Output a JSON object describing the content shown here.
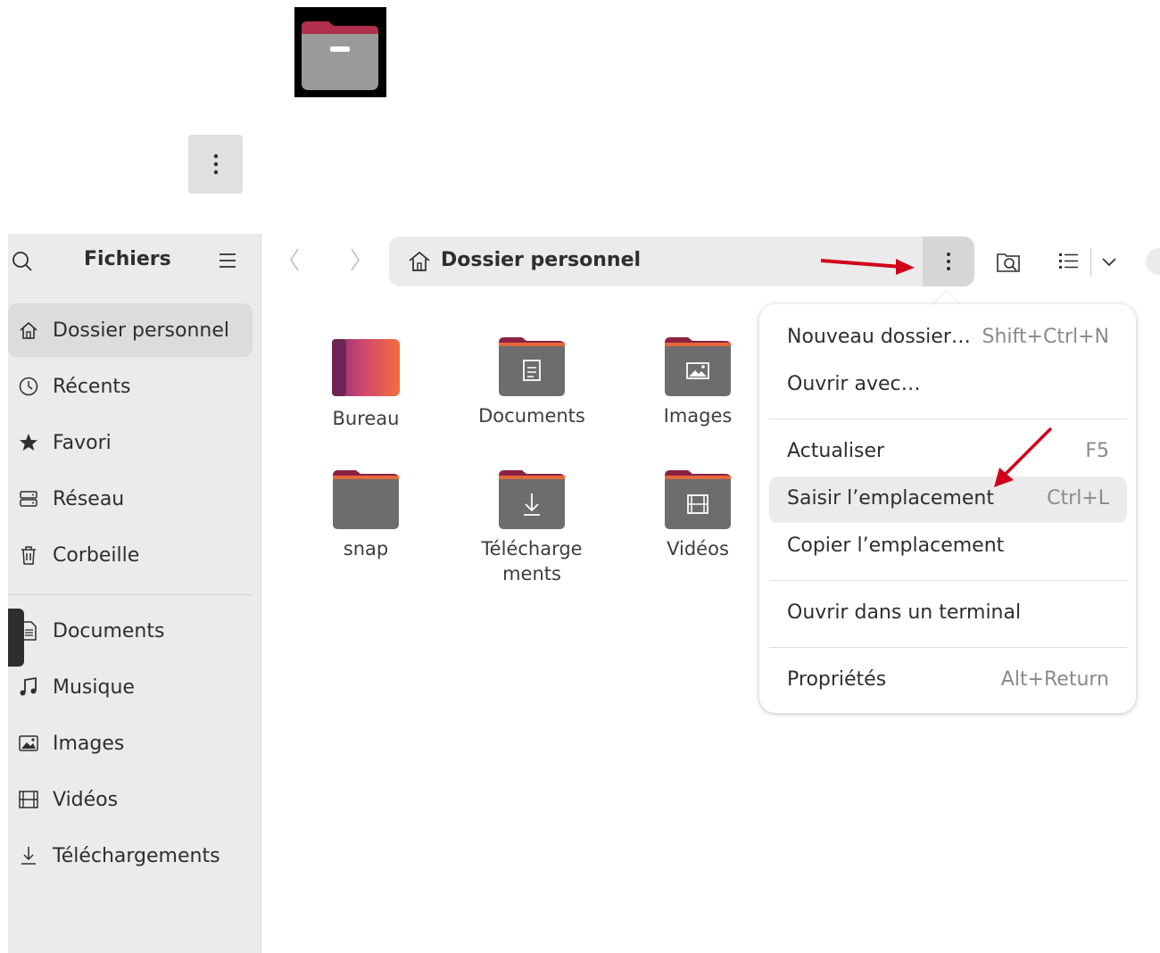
{
  "sidebar": {
    "title": "Fichiers",
    "items": [
      {
        "label": "Dossier personnel",
        "icon": "home-icon"
      },
      {
        "label": "Récents",
        "icon": "clock-icon"
      },
      {
        "label": "Favori",
        "icon": "star-icon"
      },
      {
        "label": "Réseau",
        "icon": "network-icon"
      },
      {
        "label": "Corbeille",
        "icon": "trash-icon"
      },
      {
        "label": "Documents",
        "icon": "document-icon"
      },
      {
        "label": "Musique",
        "icon": "music-icon"
      },
      {
        "label": "Images",
        "icon": "image-icon"
      },
      {
        "label": "Vidéos",
        "icon": "video-icon"
      },
      {
        "label": "Téléchargements",
        "icon": "download-icon"
      }
    ]
  },
  "header": {
    "path": "Dossier personnel"
  },
  "files": [
    {
      "name": "Bureau",
      "icon": "desktop-folder-icon"
    },
    {
      "name": "Documents",
      "icon": "documents-folder-icon"
    },
    {
      "name": "Images",
      "icon": "images-folder-icon"
    },
    {
      "name": "snap",
      "icon": "folder-icon"
    },
    {
      "name": "Télécharge\nments",
      "icon": "downloads-folder-icon"
    },
    {
      "name": "Vidéos",
      "icon": "videos-folder-icon"
    }
  ],
  "menu": {
    "items": [
      {
        "label": "Nouveau dossier…",
        "accel": "Shift+Ctrl+N"
      },
      {
        "label": "Ouvrir avec…",
        "accel": ""
      },
      {
        "label": "Actualiser",
        "accel": "F5"
      },
      {
        "label": "Saisir l’emplacement",
        "accel": "Ctrl+L",
        "highlighted": true
      },
      {
        "label": "Copier l’emplacement",
        "accel": ""
      },
      {
        "label": "Ouvrir dans un terminal",
        "accel": ""
      },
      {
        "label": "Propriétés",
        "accel": "Alt+Return"
      }
    ]
  },
  "colors": {
    "accent_orange": "#e95420",
    "folder_top": "#8b2242",
    "annotation_arrow": "#d0021b"
  }
}
